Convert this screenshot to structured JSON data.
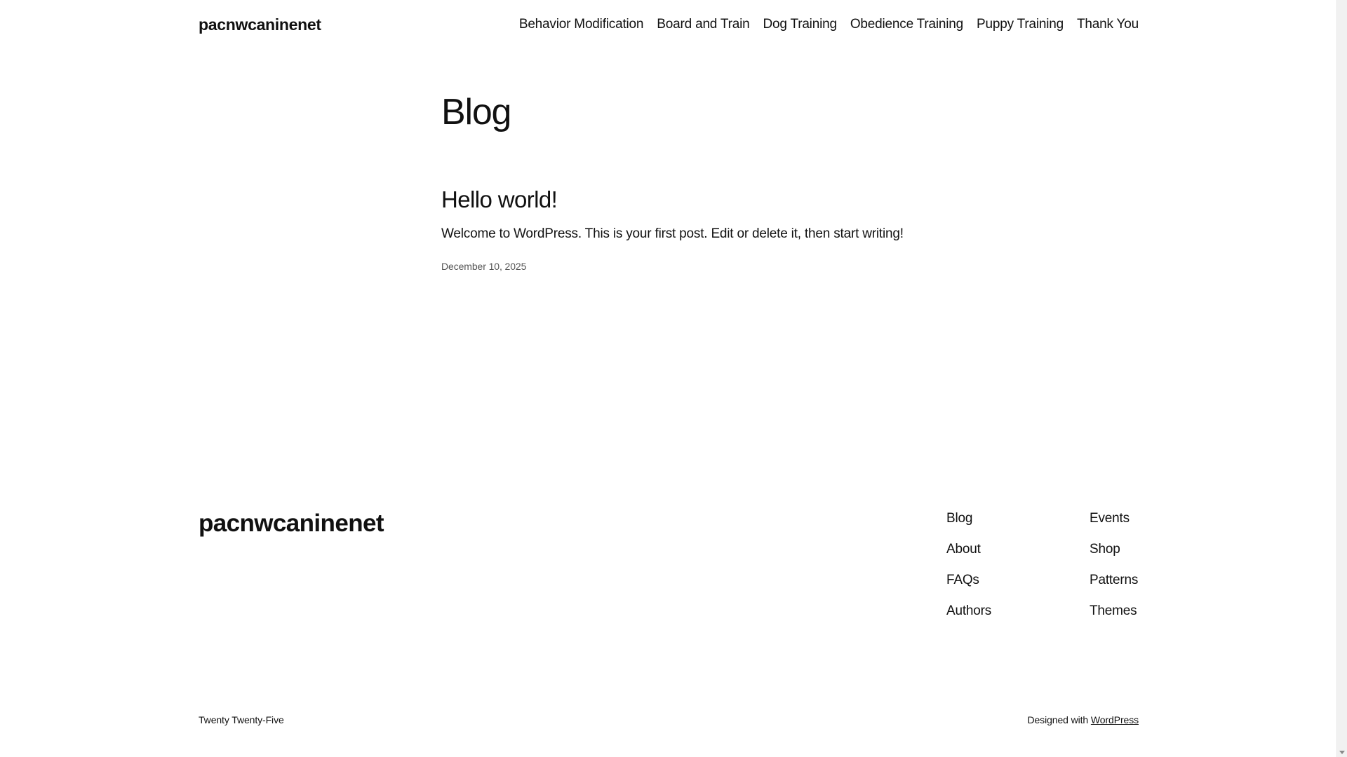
{
  "header": {
    "site_title": "pacnwcaninenet",
    "nav": [
      {
        "label": "Behavior Modification"
      },
      {
        "label": "Board and Train"
      },
      {
        "label": "Dog Training"
      },
      {
        "label": "Obedience Training"
      },
      {
        "label": "Puppy Training"
      },
      {
        "label": "Thank You"
      }
    ]
  },
  "main": {
    "heading": "Blog",
    "post": {
      "title": "Hello world!",
      "excerpt": "Welcome to WordPress. This is your first post. Edit or delete it, then start writing!",
      "date": "December 10, 2025"
    }
  },
  "footer": {
    "site_title": "pacnwcaninenet",
    "col1": [
      {
        "label": "Blog"
      },
      {
        "label": "About"
      },
      {
        "label": "FAQs"
      },
      {
        "label": "Authors"
      }
    ],
    "col2": [
      {
        "label": "Events"
      },
      {
        "label": "Shop"
      },
      {
        "label": "Patterns"
      },
      {
        "label": "Themes"
      }
    ],
    "theme_credit": "Twenty Twenty-Five",
    "designed_with_prefix": "Designed with",
    "designed_with_link": "WordPress"
  },
  "icons": {
    "scroll_down": "chevron-down-icon"
  }
}
